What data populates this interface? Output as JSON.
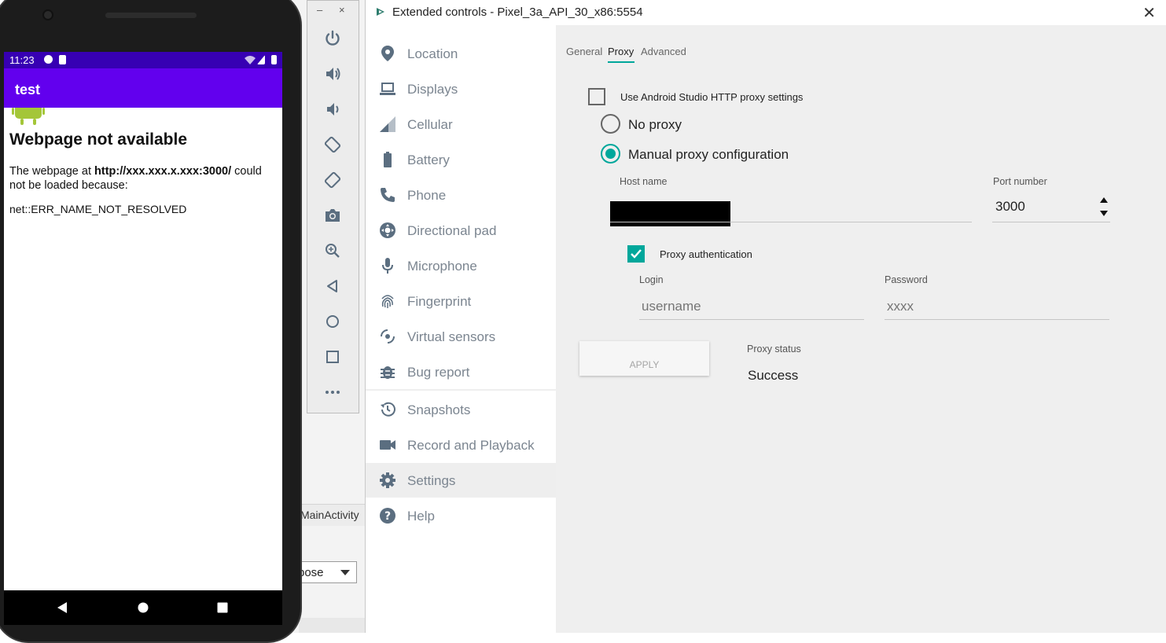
{
  "ide": {
    "tab_label": "MainActivity",
    "select_value": "bose"
  },
  "phone": {
    "status_time": "11:23",
    "app_title": "test",
    "web_title": "Webpage not available",
    "web_body_prefix": "The webpage at ",
    "web_body_url": "http://xxx.xxx.x.xxx:3000/",
    "web_body_suffix": " could not be loaded because:",
    "web_error": "net::ERR_NAME_NOT_RESOLVED"
  },
  "toolbar": {
    "minimize": "–",
    "close": "×",
    "buttons": [
      "power-icon",
      "volume-up-icon",
      "volume-down-icon",
      "rotate-left-icon",
      "rotate-right-icon",
      "camera-icon",
      "zoom-icon",
      "back-icon",
      "home-icon",
      "overview-icon",
      "more-icon"
    ]
  },
  "window": {
    "title": "Extended controls - Pixel_3a_API_30_x86:5554",
    "close": "✕"
  },
  "sidebar": {
    "items": [
      {
        "label": "Location",
        "icon": "location-icon"
      },
      {
        "label": "Displays",
        "icon": "displays-icon"
      },
      {
        "label": "Cellular",
        "icon": "cellular-icon"
      },
      {
        "label": "Battery",
        "icon": "battery-icon"
      },
      {
        "label": "Phone",
        "icon": "phone-icon"
      },
      {
        "label": "Directional pad",
        "icon": "dpad-icon"
      },
      {
        "label": "Microphone",
        "icon": "microphone-icon"
      },
      {
        "label": "Fingerprint",
        "icon": "fingerprint-icon"
      },
      {
        "label": "Virtual sensors",
        "icon": "sensors-icon"
      },
      {
        "label": "Bug report",
        "icon": "bug-icon"
      },
      {
        "label": "Snapshots",
        "icon": "history-icon"
      },
      {
        "label": "Record and Playback",
        "icon": "video-icon"
      },
      {
        "label": "Settings",
        "icon": "gear-icon"
      },
      {
        "label": "Help",
        "icon": "help-icon"
      }
    ],
    "active": "Settings"
  },
  "tabs": [
    {
      "label": "General"
    },
    {
      "label": "Proxy",
      "selected": true
    },
    {
      "label": "Advanced"
    }
  ],
  "proxy": {
    "use_studio_label": "Use Android Studio HTTP proxy settings",
    "use_studio_checked": false,
    "no_proxy_label": "No proxy",
    "manual_label": "Manual proxy configuration",
    "selected_mode": "manual",
    "host_label": "Host name",
    "host_value": "",
    "port_label": "Port number",
    "port_value": "3000",
    "auth_label": "Proxy authentication",
    "auth_checked": true,
    "login_label": "Login",
    "login_placeholder": "username",
    "password_label": "Password",
    "password_placeholder": "xxxx",
    "apply_label": "APPLY",
    "status_label": "Proxy status",
    "status_value": "Success"
  },
  "colors": {
    "accent": "#00a79b",
    "statusbar": "#3700b3",
    "appbar": "#6200ee",
    "sidebar_text": "#7b8590"
  }
}
